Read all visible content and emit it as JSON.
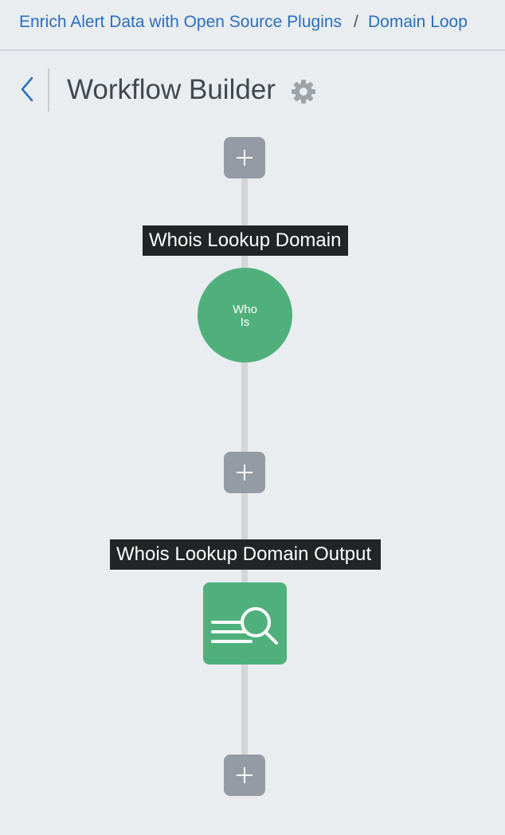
{
  "breadcrumb": {
    "parent": "Enrich Alert Data with Open Source Plugins",
    "separator": "/",
    "current": "Domain Loop"
  },
  "header": {
    "title": "Workflow Builder",
    "back_icon": "chevron-left-icon",
    "settings_icon": "gear-icon"
  },
  "workflow": {
    "add_icon": "plus-icon",
    "steps": [
      {
        "label": "Whois Lookup Domain",
        "icon_text_line1": "Who",
        "icon_text_line2": "Is"
      },
      {
        "label": "Whois Lookup Domain Output",
        "icon": "search-lines-icon"
      }
    ]
  },
  "colors": {
    "background": "#e9edf0",
    "link": "#2a6fbd",
    "step_green": "#4fb07c",
    "add_button": "#959ba4",
    "label_bg": "#222426"
  }
}
